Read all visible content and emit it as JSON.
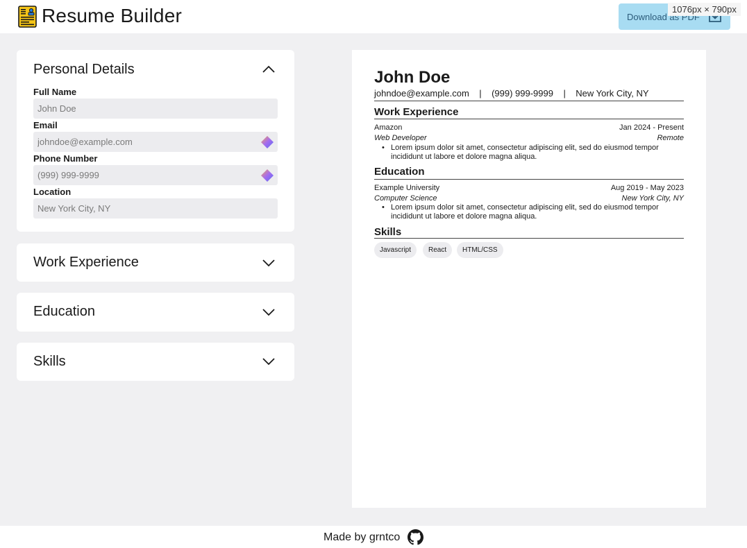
{
  "header": {
    "title": "Resume Builder",
    "logo_icon": "resume-icon",
    "download_label": "Download as PDF",
    "download_icon": "download-icon",
    "accent_color": "#a8dcf2"
  },
  "screen_badge": "1076px × 790px",
  "personal": {
    "title": "Personal Details",
    "fields": [
      {
        "label": "Full Name",
        "placeholder": "John Doe"
      },
      {
        "label": "Email",
        "placeholder": "johndoe@example.com"
      },
      {
        "label": "Phone Number",
        "placeholder": "(999) 999-9999"
      },
      {
        "label": "Location",
        "placeholder": "New York City, NY"
      }
    ]
  },
  "sections": {
    "work": "Work Experience",
    "education": "Education",
    "skills": "Skills"
  },
  "resume": {
    "name": "John Doe",
    "email": "johndoe@example.com",
    "phone": "(999) 999-9999",
    "location": "New York City, NY",
    "separator": "|",
    "work": {
      "heading": "Work Experience",
      "company": "Amazon",
      "dates": "Jan 2024 - Present",
      "role": "Web Developer",
      "place": "Remote",
      "bullet": "Lorem ipsum dolor sit amet, consectetur adipiscing elit, sed do eiusmod tempor incididunt ut labore et dolore magna aliqua."
    },
    "education": {
      "heading": "Education",
      "school": "Example University",
      "dates": "Aug 2019 - May 2023",
      "degree": "Computer Science",
      "place": "New York City, NY",
      "bullet": "Lorem ipsum dolor sit amet, consectetur adipiscing elit, sed do eiusmod tempor incididunt ut labore et dolore magna aliqua."
    },
    "skills": {
      "heading": "Skills",
      "items": [
        "Javascript",
        "React",
        "HTML/CSS"
      ]
    }
  },
  "footer": {
    "text": "Made by grntco",
    "icon": "github-icon"
  }
}
